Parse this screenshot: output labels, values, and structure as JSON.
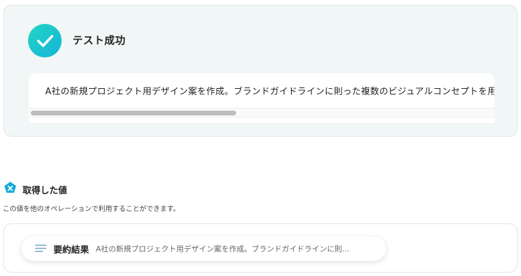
{
  "colors": {
    "accent_teal": "#25d4c4",
    "accent_blue": "#12b5d8",
    "panel_bg": "#f1f7f6"
  },
  "test": {
    "icon": "checkmark-icon",
    "title": "テスト成功",
    "result_text": "A社の新規プロジェクト用デザイン案を作成。ブランドガイドラインに則った複数のビジュアルコンセプトを用",
    "scroll_position": 0
  },
  "values": {
    "icon": "variable-x-icon",
    "title": "取得した値",
    "description": "この値を他のオペレーションで利用することができます。",
    "items": [
      {
        "icon": "text-lines-icon",
        "label": "要約結果",
        "value": "A社の新規プロジェクト用デザイン案を作成。ブランドガイドラインに則..."
      }
    ]
  }
}
